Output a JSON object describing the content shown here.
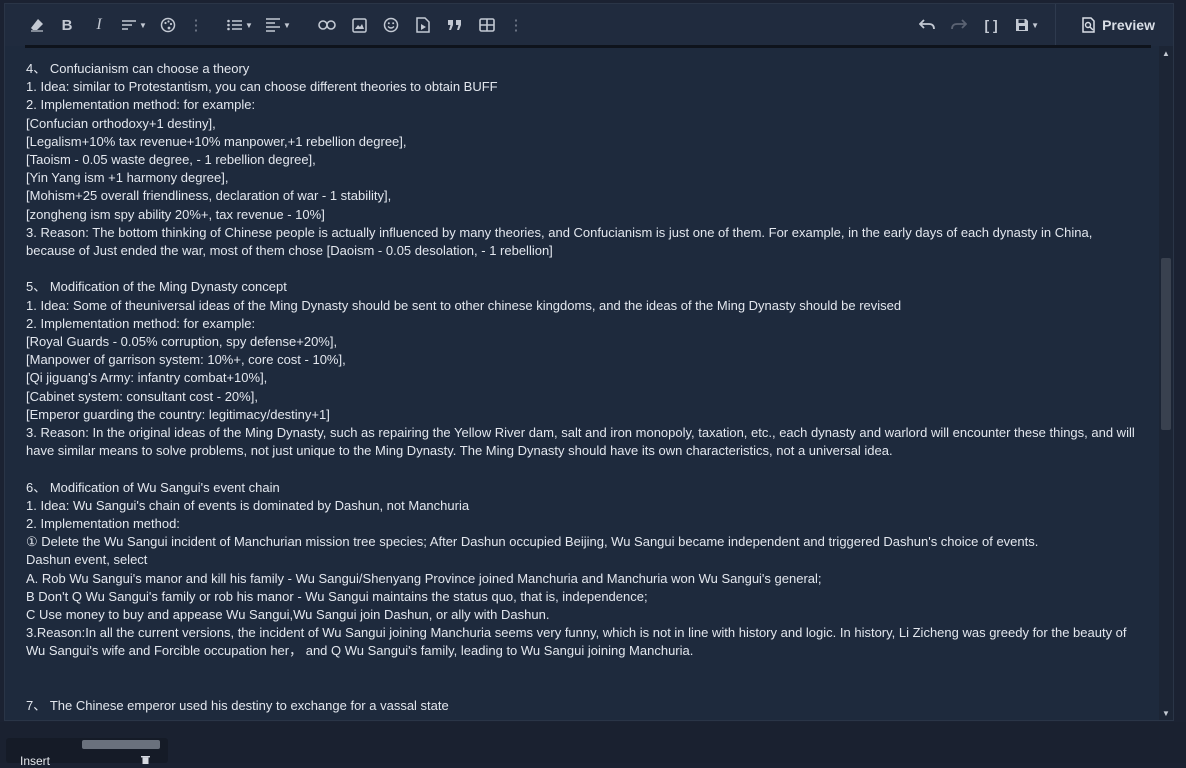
{
  "toolbar": {
    "left_tools": [
      "eraser-icon",
      "bold-icon",
      "italic-icon",
      "text-size-icon",
      "palette-icon",
      "more-icon",
      "list-icon",
      "align-icon",
      "link-icon",
      "image-icon",
      "emoji-icon",
      "media-icon",
      "quote-icon",
      "table-icon",
      "more-icon"
    ],
    "bold_label": "B",
    "italic_label": "I",
    "preview_label": "Preview"
  },
  "content": {
    "lines": [
      "4、 Confucianism can choose a theory",
      "1. Idea: similar to Protestantism, you can choose different theories to obtain BUFF",
      "2. Implementation method: for example:",
      "[Confucian orthodoxy+1 destiny],",
      "[Legalism+10% tax revenue+10% manpower,+1 rebellion degree],",
      "[Taoism - 0.05 waste degree, - 1 rebellion degree],",
      "[Yin Yang ism +1 harmony degree],",
      "[Mohism+25 overall friendliness, declaration of war - 1 stability],",
      "[zongheng ism spy ability 20%+, tax revenue - 10%]",
      "3. Reason: The bottom thinking of Chinese people is actually influenced by many theories, and Confucianism is just one of them. For example, in the early days of each dynasty in China, because of Just ended the war, most of them chose [Daoism - 0.05 desolation, - 1 rebellion]",
      "",
      "5、 Modification of the Ming Dynasty concept",
      "1. Idea: Some of theuniversal ideas of the Ming Dynasty should be sent to other chinese kingdoms, and the ideas of the Ming Dynasty should be revised",
      "2. Implementation method: for example:",
      "[Royal Guards - 0.05% corruption, spy defense+20%],",
      "[Manpower of garrison system: 10%+, core cost - 10%],",
      "[Qi jiguang's Army: infantry combat+10%],",
      "[Cabinet system: consultant cost - 20%],",
      "[Emperor guarding the country: legitimacy/destiny+1]",
      "3. Reason: In the original ideas of the Ming Dynasty, such as repairing the Yellow River dam, salt and iron monopoly, taxation, etc., each dynasty and warlord will encounter these things, and will have similar means to solve problems, not just unique to the Ming Dynasty. The Ming Dynasty should have its own characteristics, not a universal idea.",
      "",
      "6、 Modification of Wu Sangui's event chain",
      "1. Idea: Wu Sangui's chain of events is dominated by Dashun, not Manchuria",
      "2. Implementation method:",
      "① Delete the Wu Sangui incident of Manchurian mission tree species; After Dashun occupied Beijing, Wu Sangui became independent and triggered Dashun's choice of events.",
      "Dashun event, select",
      "A. Rob Wu Sangui's manor and kill his family - Wu Sangui/Shenyang Province joined Manchuria and Manchuria won Wu Sangui's general;",
      "B Don't Q Wu Sangui's family or rob his manor - Wu Sangui maintains the status quo, that is, independence;",
      "C Use money to buy and appease Wu Sangui,Wu Sangui join Dashun, or ally with Dashun.",
      "3.Reason:In all the current versions, the incident of Wu Sangui joining Manchuria seems very funny, which is not in line with history and logic. In history, Li Zicheng was greedy for the beauty of Wu Sangui's wife and Forcible occupation her， and Q Wu Sangui's family, leading to Wu Sangui joining Manchuria.",
      "",
      "",
      "7、 The Chinese emperor used his destiny to exchange for a vassal state"
    ]
  },
  "footer": {
    "insert_label": "Insert"
  },
  "colors": {
    "background": "#1b2232",
    "editor": "#1e2a3d",
    "text": "#e3e7ee"
  }
}
